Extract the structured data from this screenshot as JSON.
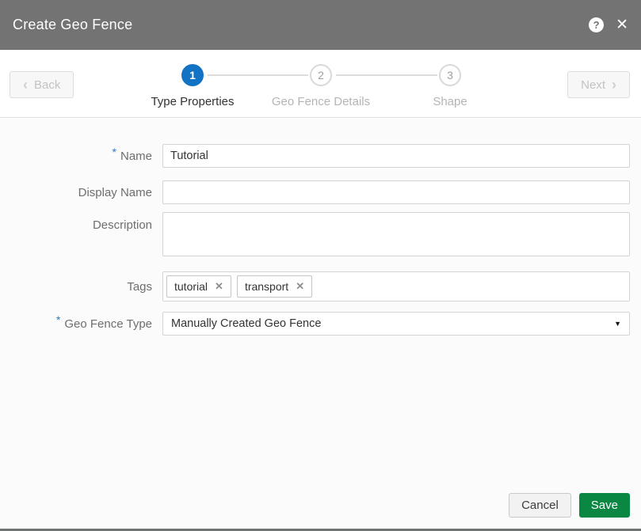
{
  "header": {
    "title": "Create Geo Fence"
  },
  "icons": {
    "help": "?",
    "close": "✕",
    "chevron_left": "‹",
    "chevron_right": "›",
    "caret_down": "▼",
    "remove_tag": "✕"
  },
  "wizard": {
    "back_label": "Back",
    "next_label": "Next",
    "steps": [
      {
        "number": "1",
        "label": "Type Properties",
        "state": "active"
      },
      {
        "number": "2",
        "label": "Geo Fence Details",
        "state": "upcoming"
      },
      {
        "number": "3",
        "label": "Shape",
        "state": "upcoming"
      }
    ]
  },
  "form": {
    "required_marker": "*",
    "name": {
      "label": "Name",
      "value": "Tutorial",
      "required": true
    },
    "display_name": {
      "label": "Display Name",
      "value": ""
    },
    "description": {
      "label": "Description",
      "value": ""
    },
    "tags": {
      "label": "Tags",
      "items": [
        "tutorial",
        "transport"
      ]
    },
    "geo_fence_type": {
      "label": "Geo Fence Type",
      "value": "Manually Created Geo Fence",
      "required": true
    }
  },
  "footer": {
    "cancel_label": "Cancel",
    "save_label": "Save"
  },
  "colors": {
    "header_bg": "#737373",
    "active_step_blue": "#1273c4",
    "save_green": "#0a8743",
    "required_asterisk_blue": "#2e77d0"
  }
}
